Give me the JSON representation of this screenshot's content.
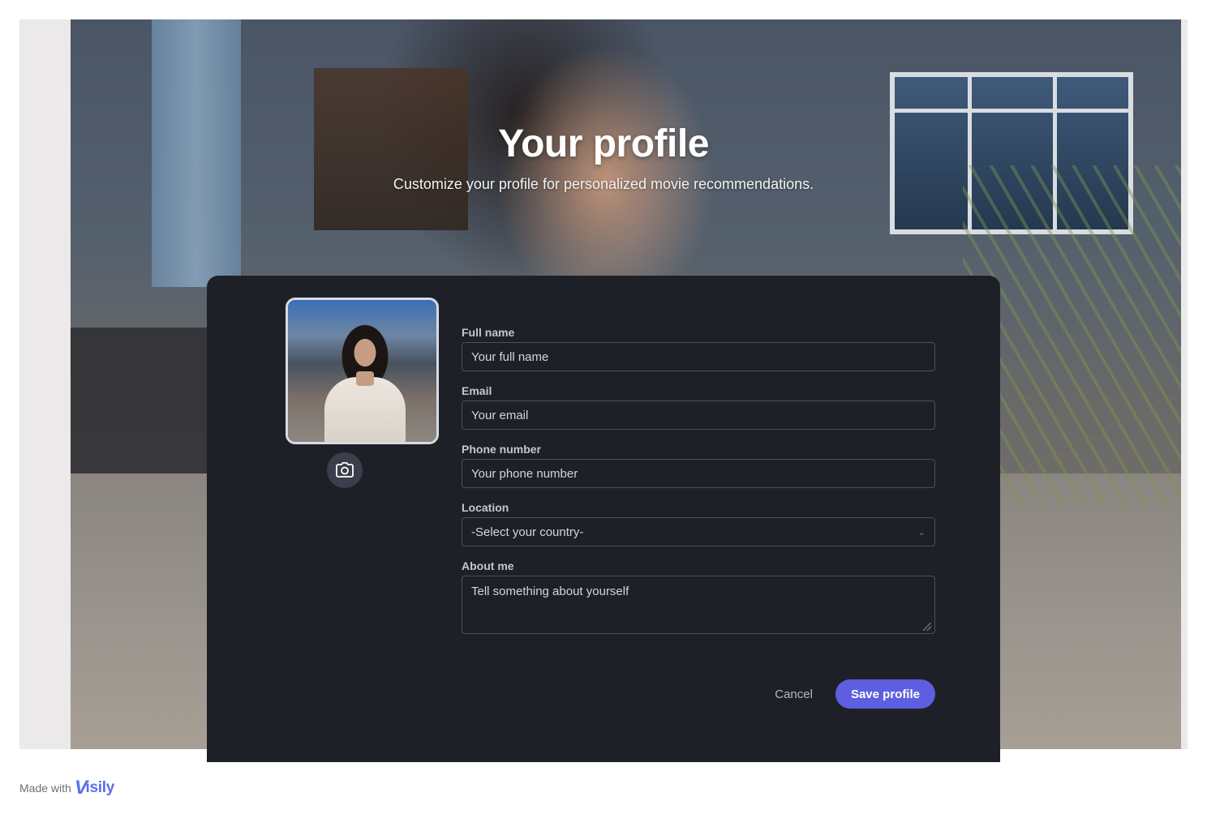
{
  "header": {
    "title": "Your profile",
    "subtitle": "Customize your profile for personalized movie recommendations."
  },
  "avatar": {
    "camera_icon": "camera-icon"
  },
  "form": {
    "full_name": {
      "label": "Full name",
      "placeholder": "Your full name"
    },
    "email": {
      "label": "Email",
      "placeholder": "Your email"
    },
    "phone": {
      "label": "Phone number",
      "placeholder": "Your phone number"
    },
    "location": {
      "label": "Location",
      "selected": "-Select your country-"
    },
    "about": {
      "label": "About me",
      "placeholder": "Tell something about yourself"
    }
  },
  "actions": {
    "cancel_label": "Cancel",
    "save_label": "Save profile"
  },
  "footer": {
    "made_with": "Made with",
    "brand": "isily",
    "brand_mark": "V"
  },
  "colors": {
    "card_bg": "#1e2028",
    "accent": "#5d5fe0",
    "brand": "#5b6ff0"
  }
}
